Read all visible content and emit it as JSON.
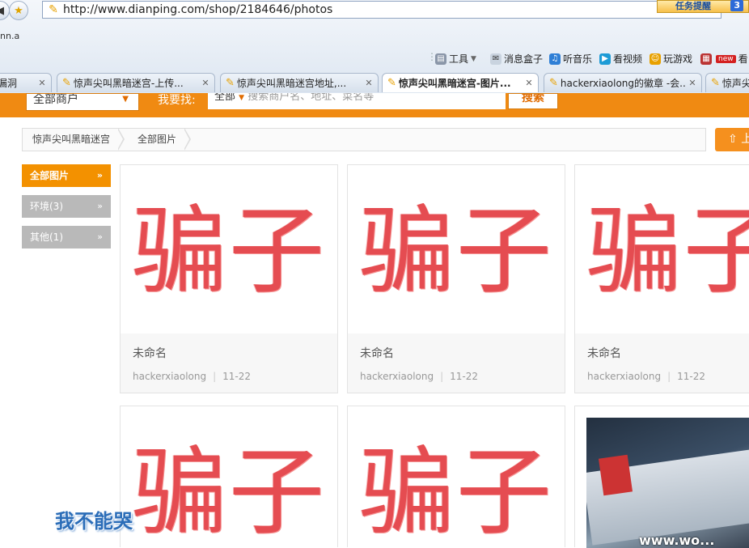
{
  "browser": {
    "url": "http://www.dianping.com/shop/2184646/photos",
    "bookmark_fragment": "nn.a",
    "promo": {
      "label": "任务提醒",
      "count": "3"
    },
    "toolbar": [
      {
        "label": "工具",
        "icon": "toolbox-icon"
      },
      {
        "label": "消息盒子",
        "icon": "message-box-icon"
      },
      {
        "label": "听音乐",
        "icon": "music-icon"
      },
      {
        "label": "看视频",
        "icon": "video-icon"
      },
      {
        "label": "玩游戏",
        "icon": "game-icon"
      },
      {
        "label": "看",
        "icon": "news-icon",
        "badge": "new"
      }
    ],
    "tabs": [
      {
        "label": "漏洞",
        "active": false
      },
      {
        "label": "惊声尖叫黑暗迷宫-上传...",
        "active": false
      },
      {
        "label": "惊声尖叫黑暗迷宫地址,...",
        "active": false
      },
      {
        "label": "惊声尖叫黑暗迷宫-图片...",
        "active": true
      },
      {
        "label": "hackerxiaolong的徽章 -会...",
        "active": false
      },
      {
        "label": "惊声尖",
        "active": false
      }
    ]
  },
  "site": {
    "scope_select": "全部商户",
    "search_label": "我要找:",
    "search_scope": "全部",
    "search_placeholder": "搜索商户名、地址、菜名等",
    "search_button": "搜索",
    "accent": "#f08a12"
  },
  "breadcrumb": [
    "惊声尖叫黑暗迷宫",
    "全部图片"
  ],
  "upload_button": "上",
  "categories": [
    {
      "label": "全部图片",
      "active": true
    },
    {
      "label": "环境(3)",
      "active": false
    },
    {
      "label": "其他(1)",
      "active": false
    }
  ],
  "photos": [
    {
      "stamp": "骗子",
      "caption": "未命名",
      "user": "hackerxiaolong",
      "date": "11-22"
    },
    {
      "stamp": "骗子",
      "caption": "未命名",
      "user": "hackerxiaolong",
      "date": "11-22"
    },
    {
      "stamp": "骗子",
      "caption": "未命名",
      "user": "hackerxiaolong",
      "date": "11-22"
    },
    {
      "stamp": "骗子"
    },
    {
      "stamp": "骗子"
    },
    {
      "image": "ticket-photo"
    }
  ],
  "watermark": {
    "text": "我不能哭",
    "url": "www.wo..."
  }
}
